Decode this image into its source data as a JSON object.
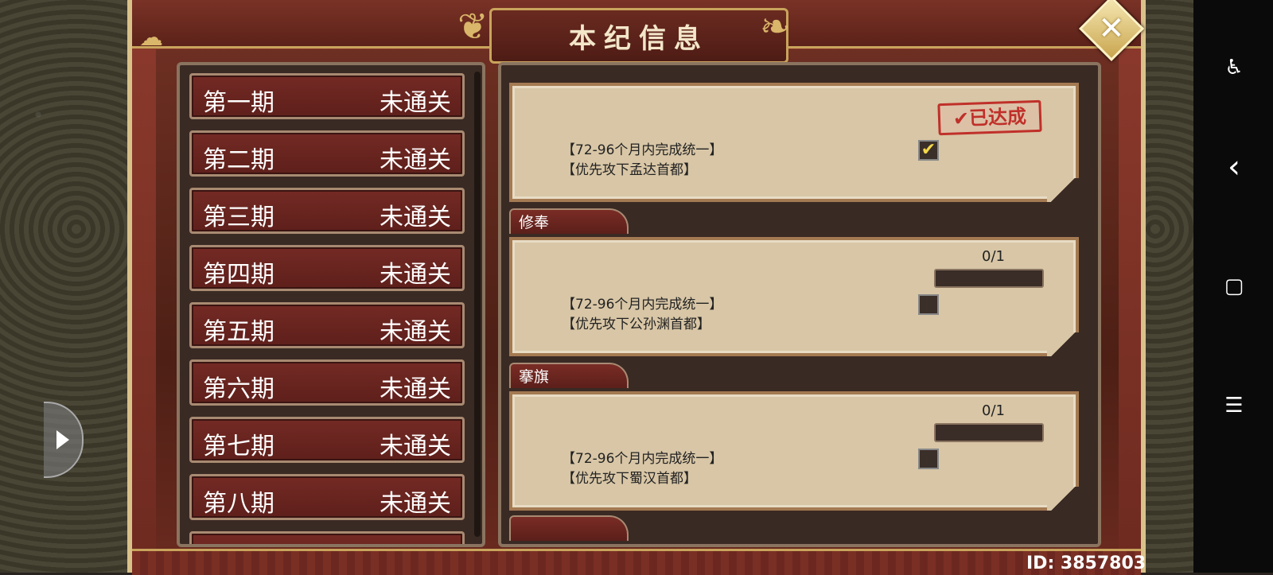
{
  "title": "本纪信息",
  "close_icon": "close-x-icon",
  "periods": [
    {
      "name": "第一期",
      "status": "未通关"
    },
    {
      "name": "第二期",
      "status": "未通关"
    },
    {
      "name": "第三期",
      "status": "未通关"
    },
    {
      "name": "第四期",
      "status": "未通关"
    },
    {
      "name": "第五期",
      "status": "未通关"
    },
    {
      "name": "第六期",
      "status": "未通关"
    },
    {
      "name": "第七期",
      "status": "未通关"
    },
    {
      "name": "第八期",
      "status": "未通关"
    }
  ],
  "tasks": [
    {
      "tab": "",
      "line1": "【72-96个月内完成统一】",
      "line2": "【优先攻下孟达首都】",
      "checked": true,
      "stamp": "✔已达成",
      "progress": ""
    },
    {
      "tab": "修奉",
      "line1": "【72-96个月内完成统一】",
      "line2": "【优先攻下公孙渊首都】",
      "checked": false,
      "progress": "0/1"
    },
    {
      "tab": "搴旗",
      "line1": "【72-96个月内完成统一】",
      "line2": "【优先攻下蜀汉首都】",
      "checked": false,
      "progress": "0/1"
    }
  ],
  "player_id": "ID: 3857803",
  "system_bar": {
    "icons": [
      "accessibility-icon",
      "back-icon",
      "home-icon",
      "menu-icon"
    ],
    "glyphs": [
      "♿",
      "‹",
      "▢",
      "☰"
    ]
  },
  "colors": {
    "frame": "#8c3a2c",
    "gold": "#c9a45c",
    "paper": "#d8c6a6",
    "stamp_red": "#c0302a"
  }
}
